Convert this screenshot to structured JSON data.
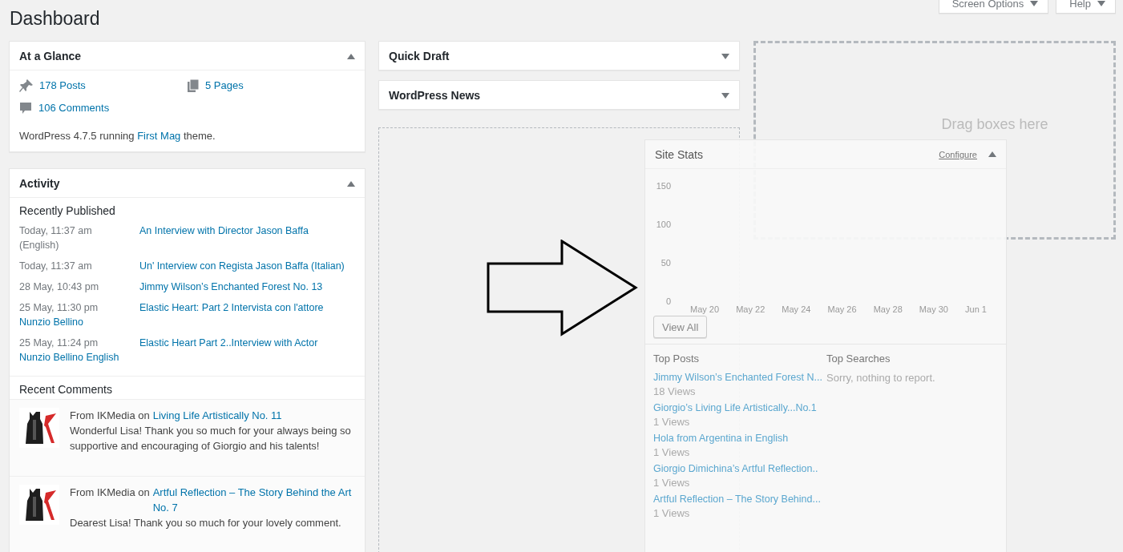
{
  "page_title": "Dashboard",
  "header_buttons": [
    {
      "label": "Screen Options"
    },
    {
      "label": "Help"
    }
  ],
  "at_a_glance": {
    "title": "At a Glance",
    "expanded": true,
    "items": [
      {
        "kind": "posts",
        "label": "178 Posts"
      },
      {
        "kind": "pages",
        "label": "5 Pages"
      },
      {
        "kind": "comments",
        "label": "106 Comments"
      }
    ],
    "version_text": "WordPress 4.7.5 running",
    "theme_link": "First Mag",
    "version_after": "theme."
  },
  "activity": {
    "title": "Activity",
    "expanded": true,
    "recently_published": "Recently Published",
    "posts": [
      {
        "date": "Today, 11:37 am",
        "title": "An Interview with Director Jason Baffa",
        "second_line": {
          "kind": "text",
          "text": "(English)"
        }
      },
      {
        "date": "Today, 11:37 am",
        "title": "Un' Interview con Regista Jason Baffa (Italian)"
      },
      {
        "date": "28 May, 10:43 pm",
        "title": "Jimmy Wilson’s Enchanted Forest No. 13"
      },
      {
        "date": "25 May, 11:30 pm",
        "title": "Elastic Heart: Part 2 Intervista con l'attore",
        "second_line": {
          "kind": "link",
          "text": "Nunzio Bellino"
        }
      },
      {
        "date": "25 May, 11:24 pm",
        "title": "Elastic Heart Part 2..Interview with Actor",
        "second_line": {
          "kind": "link",
          "text": "Nunzio Bellino English"
        }
      }
    ],
    "recent_comments": "Recent Comments",
    "comments": [
      {
        "prefix": "From IKMedia on",
        "post": "Living Life Artistically No. 11",
        "text": "Wonderful Lisa! Thank you so much for your always being so supportive and encouraging of Giorgio and his talents!"
      },
      {
        "prefix": "From IKMedia on",
        "post": "Artful Reflection – The Story Behind the Art No. 7",
        "text": "Dearest Lisa! Thank you so much for your lovely comment."
      }
    ]
  },
  "quick_draft": {
    "title": "Quick Draft",
    "expanded": false
  },
  "wordpress_news": {
    "title": "WordPress News",
    "expanded": false
  },
  "drop_zone": {
    "text": "Drag boxes here"
  },
  "site_stats": {
    "title": "Site Stats",
    "expanded": true,
    "configure": "Configure",
    "chart_data": {
      "type": "bar",
      "categories": [
        "May 20",
        "May 22",
        "May 24",
        "May 26",
        "May 28",
        "May 30",
        "Jun 1"
      ],
      "values": [
        0,
        0,
        0,
        0,
        0,
        0,
        0
      ],
      "ylim": [
        0,
        150
      ],
      "yticks": [
        0,
        50,
        100,
        150
      ]
    },
    "view_all": "View All",
    "top_posts_heading": "Top Posts",
    "top_searches_heading": "Top Searches",
    "top_posts": [
      {
        "title": "Jimmy Wilson’s Enchanted Forest N...",
        "views": "18 Views"
      },
      {
        "title": "Giorgio’s Living Life Artistically...No.1",
        "views": "1 Views"
      },
      {
        "title": "Hola from Argentina in English",
        "views": "1 Views"
      },
      {
        "title": "Giorgio Dimichina’s Artful Reflection..",
        "views": "1 Views"
      },
      {
        "title": "Artful Reflection – The Story Behind...",
        "views": "1 Views"
      }
    ],
    "top_searches_empty": "Sorry, nothing to report."
  }
}
